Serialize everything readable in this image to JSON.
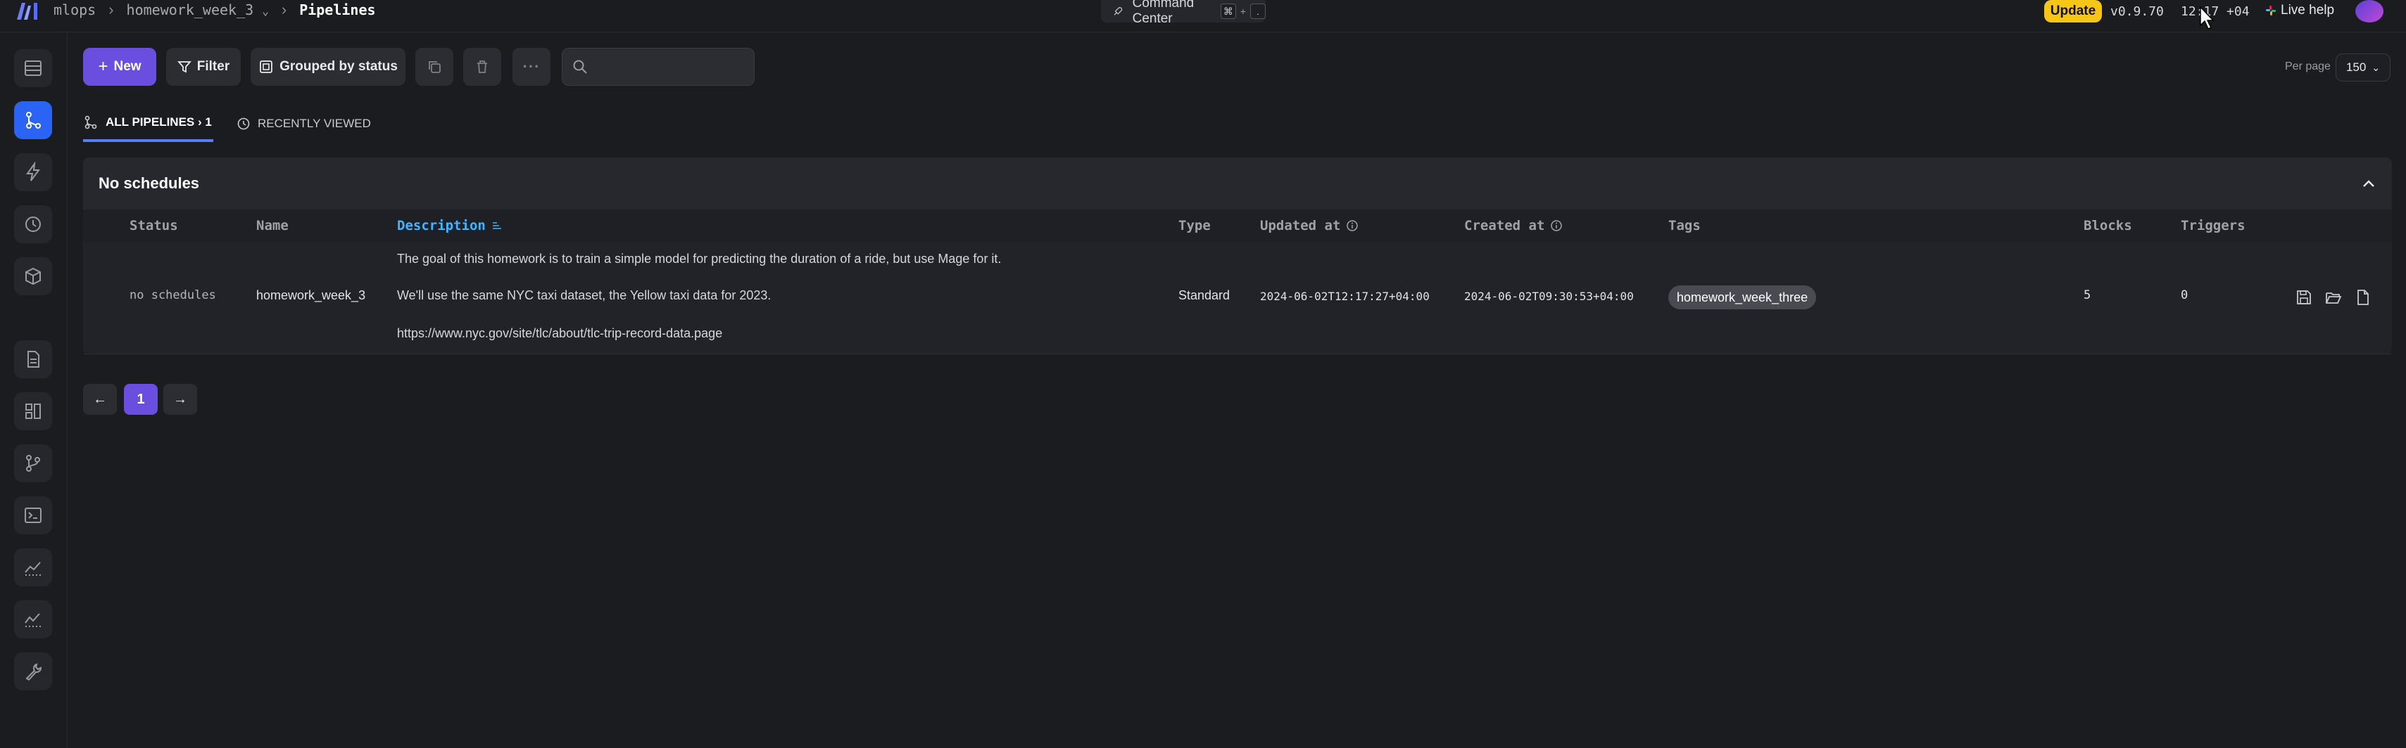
{
  "header": {
    "breadcrumb": [
      "mlops",
      "homework_week_3"
    ],
    "current_page": "Pipelines",
    "command_center": "Command Center",
    "shortcut_keys": [
      "⌘",
      "+",
      "."
    ],
    "update_label": "Update",
    "version": "v0.9.70",
    "clock": "12:17 +04",
    "live_help": "Live help"
  },
  "toolbar": {
    "new_label": "New",
    "filter_label": "Filter",
    "group_label": "Grouped by status",
    "search_placeholder": "",
    "per_page_label": "Per page",
    "per_page_value": "150"
  },
  "tabs": [
    {
      "label": "ALL PIPELINES › 1",
      "active": true
    },
    {
      "label": "RECENTLY VIEWED",
      "active": false
    }
  ],
  "group": {
    "title": "No schedules"
  },
  "table": {
    "columns": [
      "Status",
      "Name",
      "Description",
      "Type",
      "Updated at",
      "Created at",
      "Tags",
      "Blocks",
      "Triggers"
    ],
    "rows": [
      {
        "status": "no schedules",
        "name": "homework_week_3",
        "description": [
          "The goal of this homework is to train a simple model for predicting the duration of a ride, but use Mage for it.",
          "We'll use the same NYC taxi dataset, the Yellow taxi data for 2023.",
          "https://www.nyc.gov/site/tlc/about/tlc-trip-record-data.page"
        ],
        "type": "Standard",
        "updated_at": "2024-06-02T12:17:27+04:00",
        "created_at": "2024-06-02T09:30:53+04:00",
        "tags": [
          "homework_week_three"
        ],
        "blocks": "5",
        "triggers": "0"
      }
    ]
  },
  "pagination": {
    "prev": "←",
    "current": "1",
    "next": "→"
  },
  "colors": {
    "accent": "#6a4ee0",
    "active_nav": "#2b63f5",
    "sorted_column": "#3fb6ff",
    "update": "#f5c518"
  }
}
